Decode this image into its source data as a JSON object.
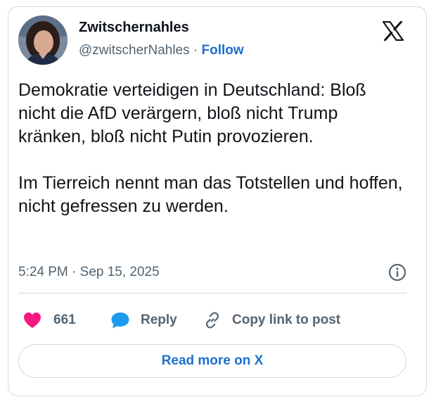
{
  "author": {
    "display_name": "Zwitschernahles",
    "handle": "@zwitscherNahles",
    "separator": "·",
    "follow_label": "Follow"
  },
  "tweet": {
    "text": "Demokratie verteidigen in Deutschland: Bloß nicht die AfD verärgern, bloß nicht Trump kränken, bloß nicht Putin provozieren.\n\nIm Tierreich nennt man das Totstellen und hoffen, nicht gefressen zu werden.",
    "timestamp": "5:24 PM · Sep 15, 2025"
  },
  "actions": {
    "like_count": "661",
    "reply_label": "Reply",
    "copy_link_label": "Copy link to post"
  },
  "read_more_label": "Read more on X",
  "icons": {
    "brand": "x-logo-icon",
    "info": "info-icon",
    "like": "heart-icon",
    "reply": "speech-bubble-icon",
    "copy": "link-icon"
  },
  "colors": {
    "link_blue": "#1d6fd0",
    "heart_pink": "#f91880",
    "reply_blue": "#1d9bf0",
    "muted_text": "#536471",
    "border": "#cfd9de"
  }
}
